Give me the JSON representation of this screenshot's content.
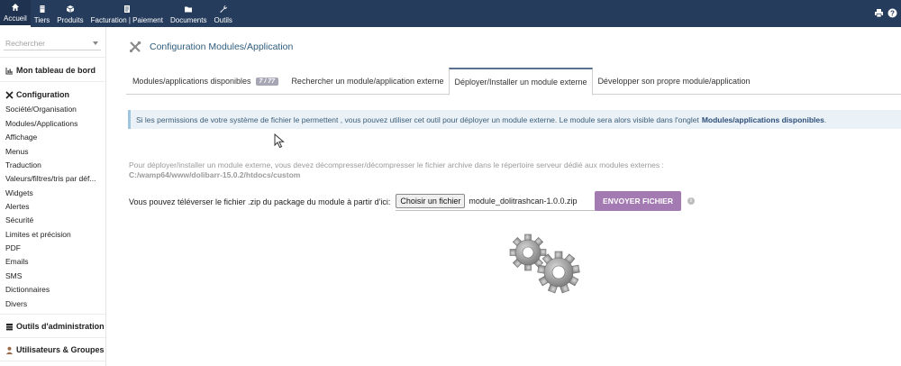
{
  "topnav": [
    {
      "label": "Accueil",
      "icon": "home-icon",
      "active": true
    },
    {
      "label": "Tiers",
      "icon": "building-icon",
      "active": false
    },
    {
      "label": "Produits",
      "icon": "cube-icon",
      "active": false
    },
    {
      "label": "Facturation | Paiement",
      "icon": "money-icon",
      "active": false
    },
    {
      "label": "Documents",
      "icon": "folder-icon",
      "active": false
    },
    {
      "label": "Outils",
      "icon": "wrench-icon",
      "active": false
    }
  ],
  "topright_icons": [
    "print-icon",
    "help-icon"
  ],
  "sidebar": {
    "search_placeholder": "Rechercher",
    "dashboard": "Mon tableau de bord",
    "configuration": "Configuration",
    "items": [
      "Société/Organisation",
      "Modules/Applications",
      "Affichage",
      "Menus",
      "Traduction",
      "Valeurs/filtres/tris par déf...",
      "Widgets",
      "Alertes",
      "Sécurité",
      "Limites et précision",
      "PDF",
      "Emails",
      "SMS",
      "Dictionnaires",
      "Divers"
    ],
    "admin_tools": "Outils d'administration",
    "users_groups": "Utilisateurs & Groupes"
  },
  "page": {
    "title": "Configuration Modules/Application",
    "tabs": [
      {
        "label": "Modules/applications disponibles",
        "badge": "7 / 77",
        "active": false
      },
      {
        "label": "Rechercher un module/application externe",
        "active": false
      },
      {
        "label": "Déployer/Installer un module externe",
        "active": true
      },
      {
        "label": "Développer son propre module/application",
        "active": false
      }
    ],
    "info_text": "Si les permissions de votre système de fichier le permettent , vous pouvez utiliser cet outil pour déployer un module externe. Le module sera alors visible dans l'onglet",
    "info_link": "Modules/applications disponibles",
    "info_end": ".",
    "help_line1": "Pour déployer/installer un module externe, vous devez décompresser/décompresser le fichier archive dans le répertoire serveur dédié aux modules externes :",
    "help_path": "C:/wamp64/www/dolibarr-15.0.2/htdocs/custom",
    "upload_label": "Vous pouvez téléverser le fichier .zip du package du module à partir d'ici:",
    "choose_file": "Choisir un fichier",
    "file_name": "module_dolitrashcan-1.0.0.zip",
    "send_button": "ENVOYER FICHIER",
    "info_icon": "i"
  },
  "colors": {
    "topbar": "#263c5c",
    "accent_button": "#a47ab3",
    "info_bg": "#eaf2f8",
    "title": "#2f5d7e"
  }
}
